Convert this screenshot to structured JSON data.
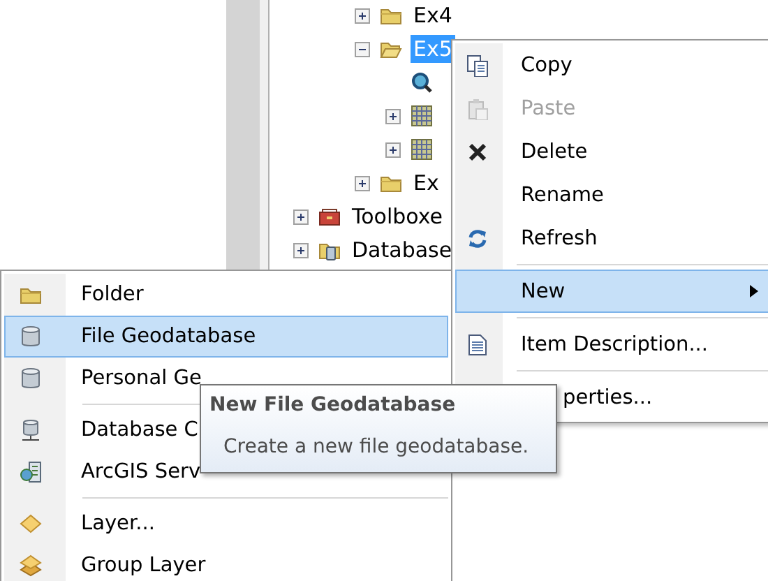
{
  "tree": {
    "items": [
      {
        "kind": "group",
        "children": [
          {
            "label": "Ex4",
            "expanded": false,
            "selected": false
          },
          {
            "label": "Ex5",
            "expanded": true,
            "selected": true,
            "children": [
              {
                "selected": false
              },
              {
                "expanded": false,
                "selected": false
              },
              {
                "expanded": false,
                "selected": false
              }
            ]
          },
          {
            "label": "Ex",
            "expanded": false,
            "selected": false
          }
        ]
      },
      {
        "label": "Toolboxe",
        "expanded": false,
        "selected": false
      },
      {
        "label": "Database",
        "expanded": false,
        "selected": false
      }
    ]
  },
  "context_menu": {
    "items": [
      {
        "kind": "item",
        "label": "Copy",
        "disabled": false,
        "selected": false
      },
      {
        "kind": "item",
        "label": "Paste",
        "disabled": true,
        "selected": false
      },
      {
        "kind": "item",
        "label": "Delete",
        "disabled": false,
        "selected": false
      },
      {
        "kind": "item",
        "label": "Rename",
        "disabled": false,
        "selected": false
      },
      {
        "kind": "item",
        "label": "Refresh",
        "disabled": false,
        "selected": false
      },
      {
        "kind": "separator"
      },
      {
        "kind": "submenu",
        "label": "New",
        "disabled": false,
        "selected": true
      },
      {
        "kind": "separator"
      },
      {
        "kind": "item",
        "label": "Item Description...",
        "disabled": false,
        "selected": false
      },
      {
        "kind": "separator"
      },
      {
        "kind": "item",
        "label": "perties...",
        "disabled": false,
        "selected": false
      }
    ]
  },
  "submenu": {
    "items": [
      {
        "kind": "item",
        "label": "Folder",
        "selected": false
      },
      {
        "kind": "item",
        "label": "File Geodatabase",
        "selected": true
      },
      {
        "kind": "item",
        "label": "Personal Ge",
        "selected": false
      },
      {
        "kind": "separator"
      },
      {
        "kind": "item",
        "label": "Database C",
        "selected": false
      },
      {
        "kind": "item",
        "label": "ArcGIS Serv",
        "selected": false
      },
      {
        "kind": "separator"
      },
      {
        "kind": "item",
        "label": "Layer...",
        "selected": false
      },
      {
        "kind": "item",
        "label": "Group Layer",
        "selected": false
      }
    ]
  },
  "tooltip": {
    "title": "New File Geodatabase",
    "text": "Create a new file geodatabase."
  }
}
